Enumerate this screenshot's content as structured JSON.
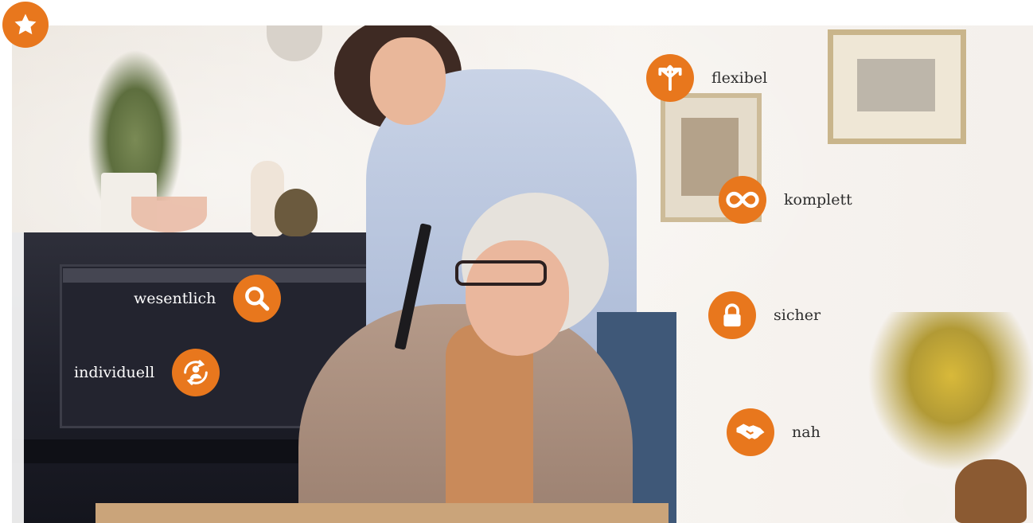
{
  "features": {
    "flexibel": {
      "label": "flexibel",
      "icon": "diverging-arrows-icon"
    },
    "komplett": {
      "label": "komplett",
      "icon": "infinity-icon"
    },
    "sicher": {
      "label": "sicher",
      "icon": "padlock-icon"
    },
    "nah": {
      "label": "nah",
      "icon": "handshake-icon"
    },
    "wesentlich": {
      "label": "wesentlich",
      "icon": "magnifier-icon"
    },
    "individuell": {
      "label": "individuell",
      "icon": "person-cycle-icon"
    }
  },
  "badge": {
    "icon": "star-icon"
  },
  "colors": {
    "accent": "#e8771d",
    "label_dark": "#2e2e2e",
    "label_light": "#ffffff"
  }
}
